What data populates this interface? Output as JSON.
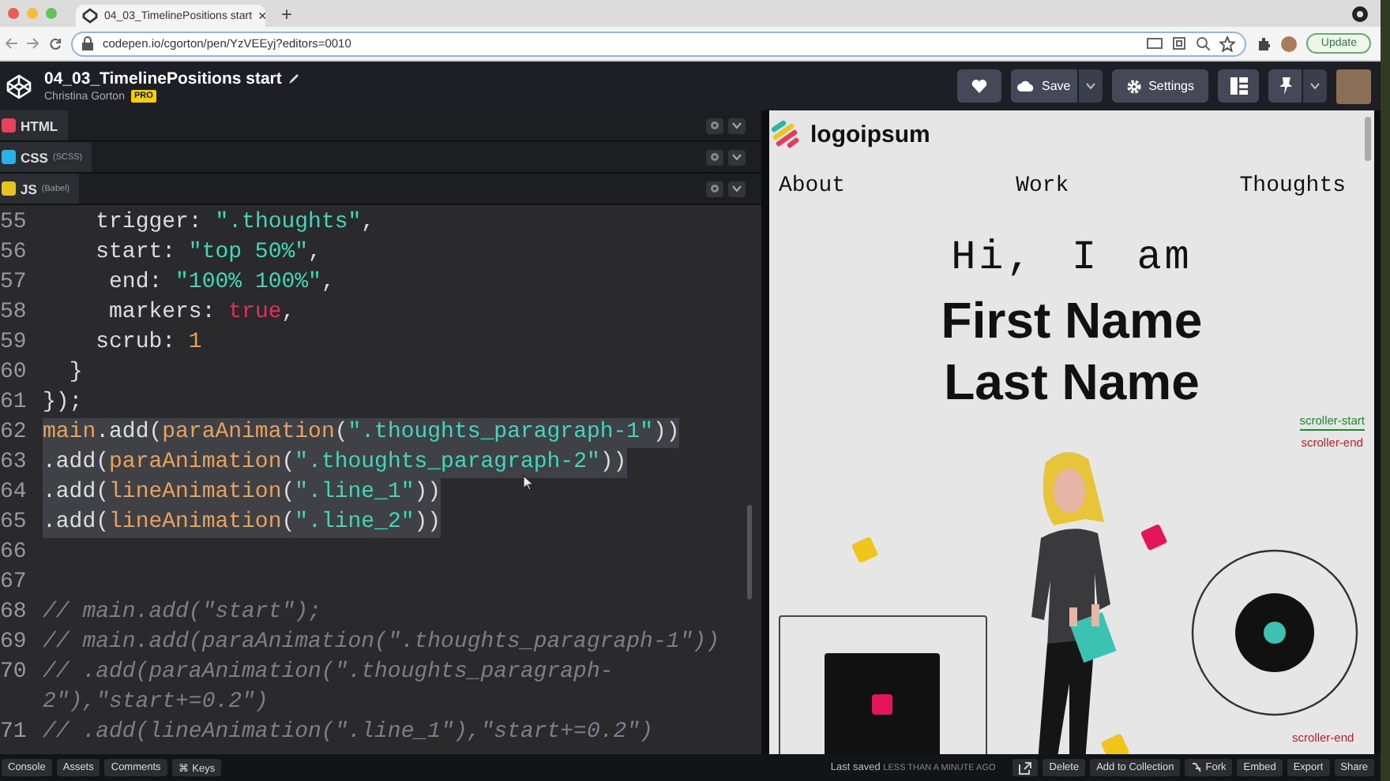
{
  "browser": {
    "tab_title": "04_03_TimelinePositions start",
    "tab_close": "×",
    "new_tab": "+",
    "address": "codepen.io/cgorton/pen/YzVEEyj?editors=0010",
    "update_button": "Update"
  },
  "header": {
    "title": "04_03_TimelinePositions start",
    "author": "Christina Gorton",
    "badge": "PRO",
    "save_button": "Save",
    "settings_button": "Settings"
  },
  "editor_tabs": [
    {
      "label": "HTML",
      "color": "#e8425a"
    },
    {
      "label": "CSS",
      "note": "(SCSS)",
      "color": "#2ab1e8"
    },
    {
      "label": "JS",
      "note": "(Babel)",
      "color": "#e8c421"
    }
  ],
  "code_lines": [
    {
      "number": "55",
      "highlighted": false,
      "tokens": [
        {
          "kind": "plain",
          "text": "    trigger: "
        },
        {
          "kind": "string",
          "text": "\".thoughts\""
        },
        {
          "kind": "plain",
          "text": ","
        }
      ]
    },
    {
      "number": "56",
      "highlighted": false,
      "tokens": [
        {
          "kind": "plain",
          "text": "    start: "
        },
        {
          "kind": "string",
          "text": "\"top 50%\""
        },
        {
          "kind": "plain",
          "text": ","
        }
      ]
    },
    {
      "number": "57",
      "highlighted": false,
      "tokens": [
        {
          "kind": "plain",
          "text": "     end: "
        },
        {
          "kind": "string",
          "text": "\"100% 100%\""
        },
        {
          "kind": "plain",
          "text": ","
        }
      ]
    },
    {
      "number": "58",
      "highlighted": false,
      "tokens": [
        {
          "kind": "plain",
          "text": "     markers: "
        },
        {
          "kind": "keyword",
          "text": "true"
        },
        {
          "kind": "plain",
          "text": ","
        }
      ]
    },
    {
      "number": "59",
      "highlighted": false,
      "tokens": [
        {
          "kind": "plain",
          "text": "    scrub: "
        },
        {
          "kind": "number",
          "text": "1"
        }
      ]
    },
    {
      "number": "60",
      "highlighted": false,
      "tokens": [
        {
          "kind": "plain",
          "text": "  }"
        }
      ]
    },
    {
      "number": "61",
      "highlighted": false,
      "tokens": [
        {
          "kind": "plain",
          "text": "});"
        }
      ]
    },
    {
      "number": "62",
      "highlighted": true,
      "tokens": [
        {
          "kind": "function",
          "text": "main"
        },
        {
          "kind": "plain",
          "text": ".add("
        },
        {
          "kind": "function",
          "text": "paraAnimation"
        },
        {
          "kind": "plain",
          "text": "("
        },
        {
          "kind": "string",
          "text": "\".thoughts_paragraph-1\""
        },
        {
          "kind": "plain",
          "text": "))"
        }
      ]
    },
    {
      "number": "63",
      "highlighted": true,
      "tokens": [
        {
          "kind": "plain",
          "text": ".add("
        },
        {
          "kind": "function",
          "text": "paraAnimation"
        },
        {
          "kind": "plain",
          "text": "("
        },
        {
          "kind": "string",
          "text": "\".thoughts_paragraph-2\""
        },
        {
          "kind": "plain",
          "text": "))"
        }
      ]
    },
    {
      "number": "64",
      "highlighted": true,
      "tokens": [
        {
          "kind": "plain",
          "text": ".add("
        },
        {
          "kind": "function",
          "text": "lineAnimation"
        },
        {
          "kind": "plain",
          "text": "("
        },
        {
          "kind": "string",
          "text": "\".line_1\""
        },
        {
          "kind": "plain",
          "text": "))"
        }
      ]
    },
    {
      "number": "65",
      "highlighted": true,
      "tokens": [
        {
          "kind": "plain",
          "text": ".add("
        },
        {
          "kind": "function",
          "text": "lineAnimation"
        },
        {
          "kind": "plain",
          "text": "("
        },
        {
          "kind": "string",
          "text": "\".line_2\""
        },
        {
          "kind": "plain",
          "text": "))"
        }
      ]
    },
    {
      "number": "66",
      "highlighted": false
    },
    {
      "number": "67",
      "highlighted": false
    },
    {
      "number": "68",
      "highlighted": false,
      "tokens": [
        {
          "kind": "comment",
          "text": "// main.add(\"start\");"
        }
      ]
    },
    {
      "number": "69",
      "highlighted": false,
      "tokens": [
        {
          "kind": "comment",
          "text": "// main.add(paraAnimation(\".thoughts_paragraph-1\"))"
        }
      ]
    },
    {
      "number": "70",
      "highlighted": false,
      "tokens": [
        {
          "kind": "comment",
          "text": "// .add(paraAnimation(\".thoughts_paragraph-2\"),\"start+=0.2\")"
        }
      ]
    },
    {
      "number": "71",
      "highlighted": false,
      "tokens": [
        {
          "kind": "comment",
          "text": "// .add(lineAnimation(\".line_1\"),\"start+=0.2\")"
        }
      ]
    }
  ],
  "preview": {
    "logo": "logoipsum",
    "nav": [
      "About",
      "Work",
      "Thoughts"
    ],
    "greeting": "Hi, I am",
    "name_lines": [
      "First Name",
      "Last Name"
    ],
    "markers": [
      {
        "kind": "start",
        "label": "scroller-start"
      },
      {
        "kind": "end",
        "label": "scroller-end"
      }
    ],
    "bottom_marker": {
      "kind": "end",
      "label": "scroller-end"
    }
  },
  "bottom_bar": {
    "left_buttons": [
      "Console",
      "Assets",
      "Comments",
      "⌘ Keys"
    ],
    "save_label": "Last saved",
    "save_time": "LESS THAN A MINUTE AGO",
    "right_buttons": [
      {
        "kind": "icon"
      },
      {
        "kind": "text",
        "label": "Delete"
      },
      {
        "kind": "text",
        "label": "Add to Collection"
      },
      {
        "kind": "fork",
        "label": "Fork"
      },
      {
        "kind": "text",
        "label": "Embed"
      },
      {
        "kind": "text",
        "label": "Export"
      },
      {
        "kind": "text",
        "label": "Share"
      }
    ]
  }
}
